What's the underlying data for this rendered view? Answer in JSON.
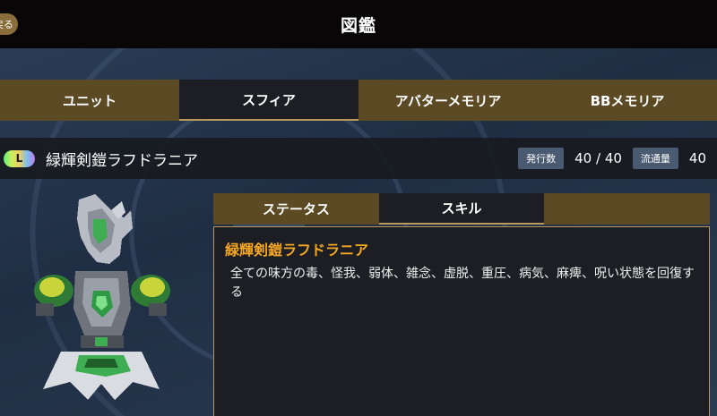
{
  "header": {
    "title": "図鑑",
    "back_label": "戻る"
  },
  "tabs": [
    {
      "label": "ユニット",
      "active": false
    },
    {
      "label": "スフィア",
      "active": true
    },
    {
      "label": "アバターメモリア",
      "active": false
    },
    {
      "label": "BBメモリア",
      "active": false
    }
  ],
  "sphere": {
    "rarity": "L",
    "name": "緑輝剣鎧ラフドラニア",
    "issued_label": "発行数",
    "issued_value": "40 / 40",
    "circulation_label": "流通量",
    "circulation_value": "40"
  },
  "subtabs": [
    {
      "label": "ステータス",
      "active": false
    },
    {
      "label": "スキル",
      "active": true
    },
    {
      "label": "",
      "active": false
    }
  ],
  "skill": {
    "name": "緑輝剣鎧ラフドラニア",
    "description": "全ての味方の毒、怪我、弱体、雑念、虚脱、重圧、病気、麻痺、呪い状態を回復する"
  },
  "colors": {
    "accent": "#f5a623",
    "tab_bg": "#5b4a23",
    "panel_bg": "#1c1e24",
    "border": "#b79a5a"
  }
}
